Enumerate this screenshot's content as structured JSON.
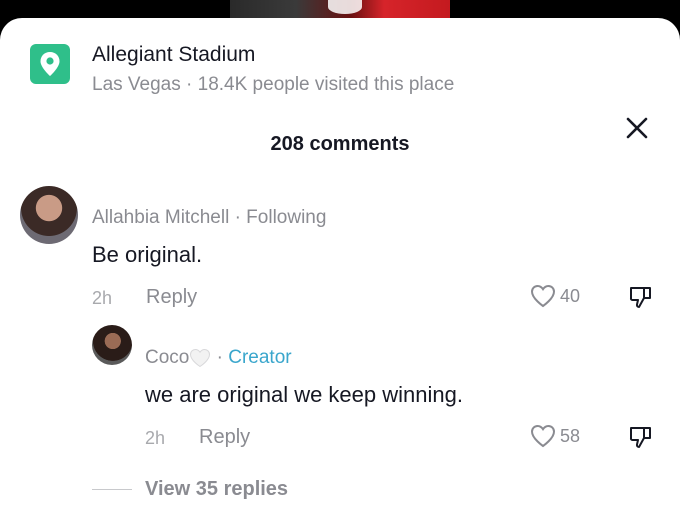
{
  "location": {
    "title": "Allegiant Stadium",
    "subtitle": "Las Vegas · 18.4K people visited this place",
    "icon": "map-pin-icon",
    "icon_color": "#2fbf8a"
  },
  "header": {
    "title": "208 comments",
    "close_icon": "close-icon"
  },
  "comments": [
    {
      "author": "Allahbia Mitchell",
      "relation": " · Following",
      "text": "Be original.",
      "time": "2h",
      "reply_label": "Reply",
      "likes": "40"
    }
  ],
  "reply": {
    "author": "Coco",
    "separator": " · ",
    "badge": "Creator",
    "text": "we are original we keep winning.",
    "time": "2h",
    "reply_label": "Reply",
    "likes": "58"
  },
  "view_replies": "View 35 replies",
  "colors": {
    "text_primary": "#161823",
    "text_secondary": "#8a8b91",
    "creator_accent": "#3aa6cc"
  }
}
